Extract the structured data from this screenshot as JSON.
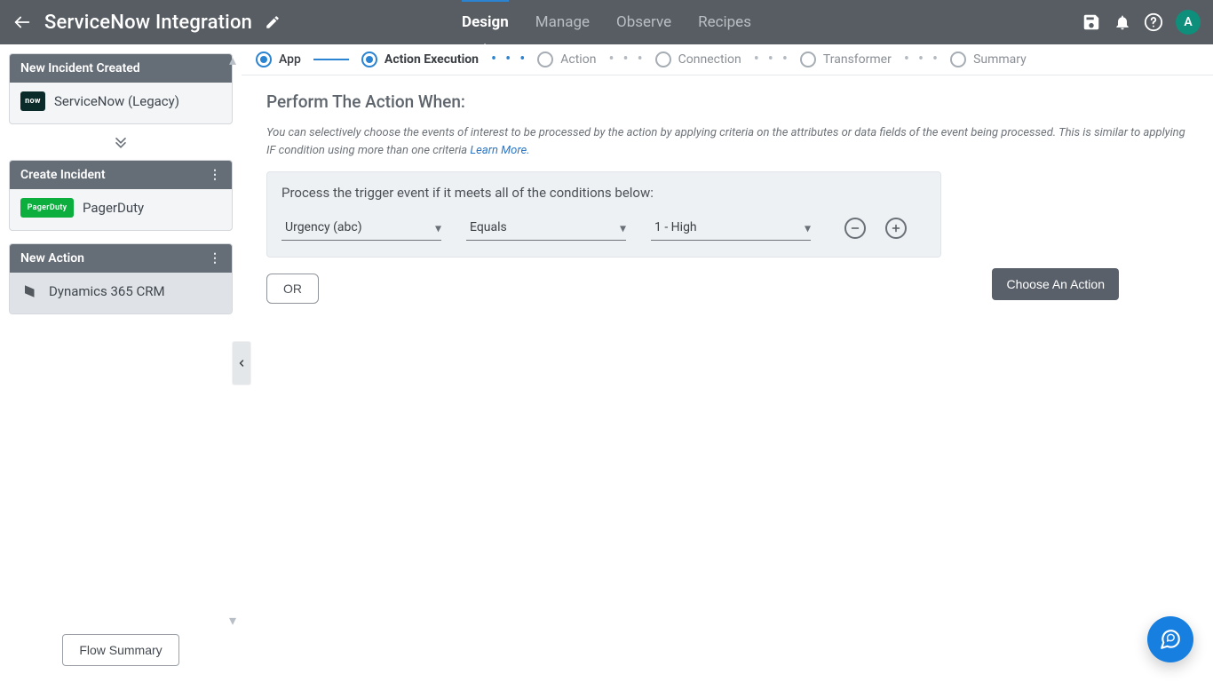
{
  "header": {
    "title": "ServiceNow Integration",
    "tabs": [
      "Design",
      "Manage",
      "Observe",
      "Recipes"
    ],
    "active_tab_index": 0,
    "avatar_initial": "A"
  },
  "steps": {
    "items": [
      {
        "label": "App",
        "state": "done"
      },
      {
        "label": "Action Execution",
        "state": "active"
      },
      {
        "label": "Action",
        "state": "pending"
      },
      {
        "label": "Connection",
        "state": "pending"
      },
      {
        "label": "Transformer",
        "state": "pending"
      },
      {
        "label": "Summary",
        "state": "pending"
      }
    ]
  },
  "sidebar": {
    "cards": [
      {
        "header": "New Incident Created",
        "app": "ServiceNow (Legacy)",
        "chip": "now",
        "chip_text": "now",
        "has_menu": false,
        "selected": false
      },
      {
        "header": "Create Incident",
        "app": "PagerDuty",
        "chip": "pager",
        "chip_text": "PagerDuty",
        "has_menu": true,
        "selected": false
      },
      {
        "header": "New Action",
        "app": "Dynamics 365 CRM",
        "chip": "d365",
        "chip_text": "",
        "has_menu": true,
        "selected": true
      }
    ],
    "flow_summary_label": "Flow Summary"
  },
  "content": {
    "heading": "Perform The Action When:",
    "help_text": "You can selectively choose the events of interest to be processed by the action by applying criteria on the attributes or data fields of the event being processed. This is similar to applying IF condition using more than one criteria ",
    "learn_more": "Learn More.",
    "cond_title": "Process the trigger event if it meets all of the conditions below:",
    "condition": {
      "field": "Urgency (abc)",
      "operator": "Equals",
      "value": "1 - High"
    },
    "or_label": "OR",
    "choose_action_label": "Choose An Action"
  }
}
